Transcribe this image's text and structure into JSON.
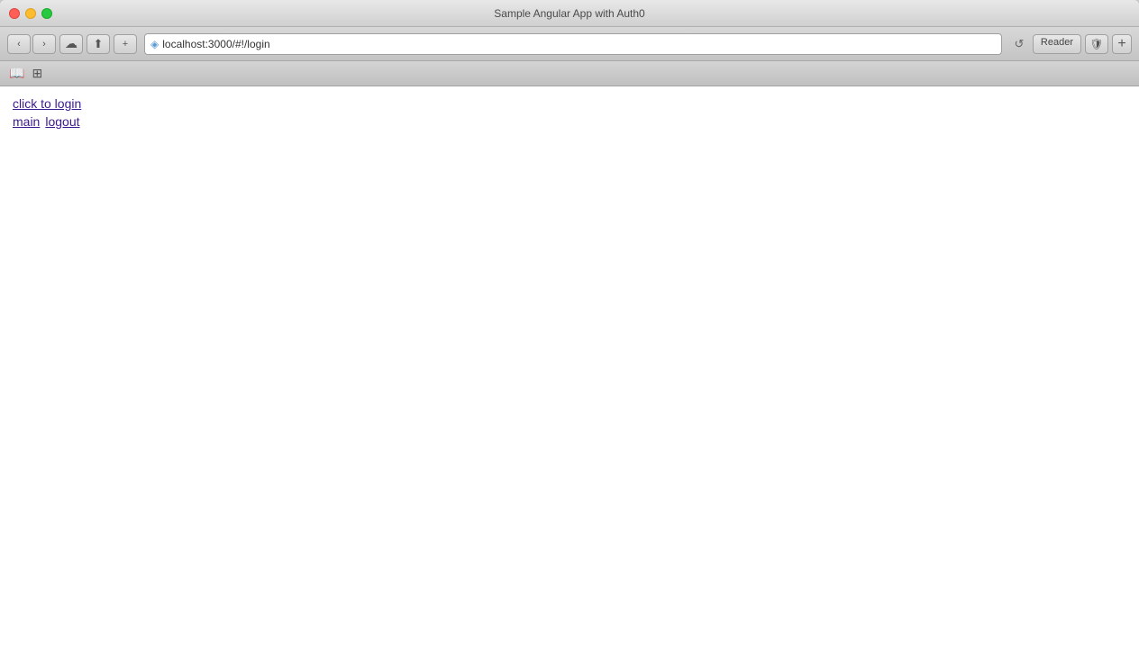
{
  "browser": {
    "title": "Sample Angular App with Auth0",
    "url": "localhost:3000/#!/login",
    "back_disabled": false,
    "forward_disabled": false
  },
  "toolbar": {
    "sidebar_icon": "☰",
    "grid_icon": "⊞",
    "back_arrow": "‹",
    "forward_arrow": "›",
    "cloud_icon": "☁",
    "share_icon": "⬆",
    "add_tab_icon": "+",
    "refresh_icon": "↺",
    "reader_label": "Reader",
    "lock_icon": "◈",
    "shield_icon": "🛡"
  },
  "page": {
    "click_to_login_label": "click to login",
    "main_label": "main",
    "logout_label": "logout"
  }
}
